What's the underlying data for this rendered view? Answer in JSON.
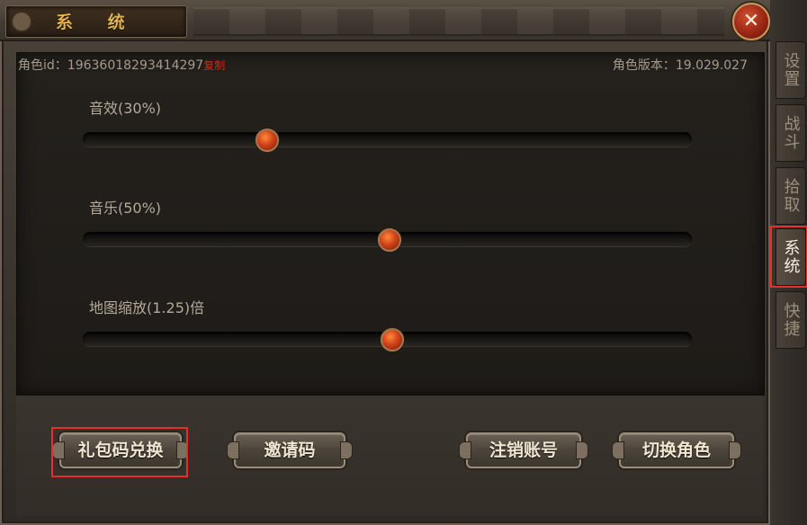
{
  "window": {
    "title": "系 统",
    "close_symbol": "✕"
  },
  "info": {
    "role_id_label": "角色id：",
    "role_id_value": "19636018293414297",
    "copy_link": "复制",
    "version_label": "角色版本：",
    "version_value": "19.029.027"
  },
  "sliders": [
    {
      "label": "音效(30%)",
      "value": 0.3
    },
    {
      "label": "音乐(50%)",
      "value": 0.5
    },
    {
      "label": "地图缩放(1.25)倍",
      "value": 0.505
    }
  ],
  "buttons": {
    "gift_code": "礼包码兑换",
    "invite_code": "邀请码",
    "cancel_account": "注销账号",
    "switch_role": "切换角色"
  },
  "tabs": [
    {
      "label": "设置",
      "active": false
    },
    {
      "label": "战斗",
      "active": false
    },
    {
      "label": "拾取",
      "active": false
    },
    {
      "label": "系统",
      "active": true
    },
    {
      "label": "快捷",
      "active": false
    }
  ],
  "colors": {
    "highlight": "#e8302a",
    "title": "#e0b24a",
    "copy_link": "#d8231b"
  }
}
